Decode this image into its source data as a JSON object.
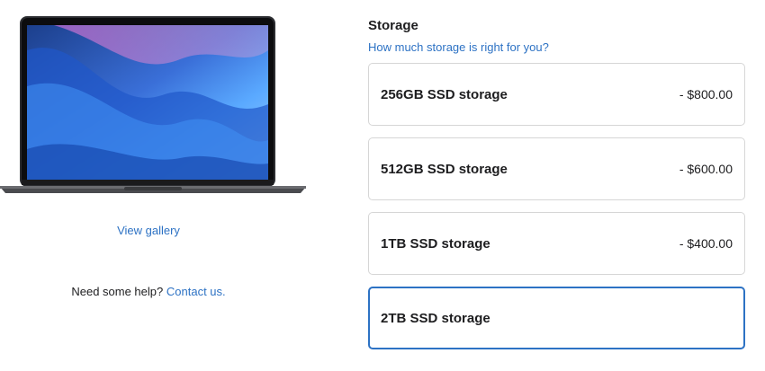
{
  "product": {
    "image_alt": "MacBook Air",
    "gallery_link": "View gallery",
    "help_text": "Need some help?",
    "contact_link": "Contact us."
  },
  "storage": {
    "title": "Storage",
    "help_link": "How much storage is right for you?",
    "options": [
      {
        "label": "256GB SSD storage",
        "price": "- $800.00",
        "selected": false
      },
      {
        "label": "512GB SSD storage",
        "price": "- $600.00",
        "selected": false
      },
      {
        "label": "1TB SSD storage",
        "price": "- $400.00",
        "selected": false
      },
      {
        "label": "2TB SSD storage",
        "price": "",
        "selected": true
      }
    ]
  },
  "colors": {
    "link": "#2d72c4",
    "selected_border": "#2d72c4",
    "border": "#d6d6d6",
    "laptop_body": "#4a4b4f"
  }
}
